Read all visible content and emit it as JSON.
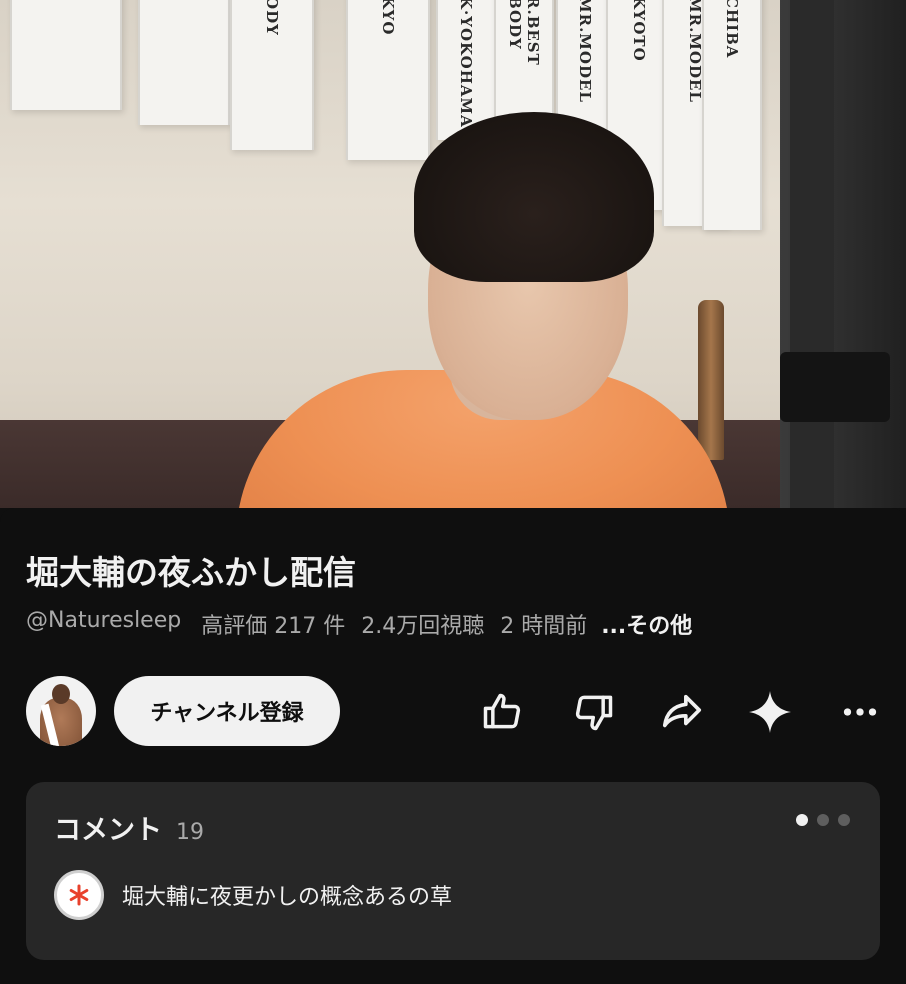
{
  "video": {
    "sashes": [
      "ODY",
      "KYO",
      "K·YOKOHAMA",
      "R.BEST BODY",
      "MR.MODEL",
      "KYOTO",
      "MR.MODEL",
      "CHIBA"
    ]
  },
  "title": "堀大輔の夜ふかし配信",
  "meta": {
    "channel": "@Naturesleep",
    "likes": "高評価 217 件",
    "views": "2.4万回視聴",
    "age": "2 時間前",
    "more": "...その他"
  },
  "channel": {
    "avatar_icon": "channel-avatar",
    "subscribe_label": "チャンネル登録"
  },
  "actions": [
    {
      "name": "like-button",
      "icon": "thumbs-up-icon"
    },
    {
      "name": "dislike-button",
      "icon": "thumbs-down-icon"
    },
    {
      "name": "share-button",
      "icon": "share-arrow-icon"
    },
    {
      "name": "ask-button",
      "icon": "sparkle-icon"
    },
    {
      "name": "more-actions-button",
      "icon": "more-horizontal-icon"
    }
  ],
  "comments": {
    "label": "コメント",
    "count": "19",
    "pager_active": 1,
    "pager_total": 3,
    "top_comment": {
      "avatar_icon": "asterisk-avatar-icon",
      "text": "堀大輔に夜更かしの概念あるの草"
    }
  },
  "colors": {
    "background": "#0f0f0f",
    "card": "#272727",
    "text": "#f1f1f1",
    "muted": "#aaaaaa",
    "avatar_asterisk": "#e8412c"
  }
}
